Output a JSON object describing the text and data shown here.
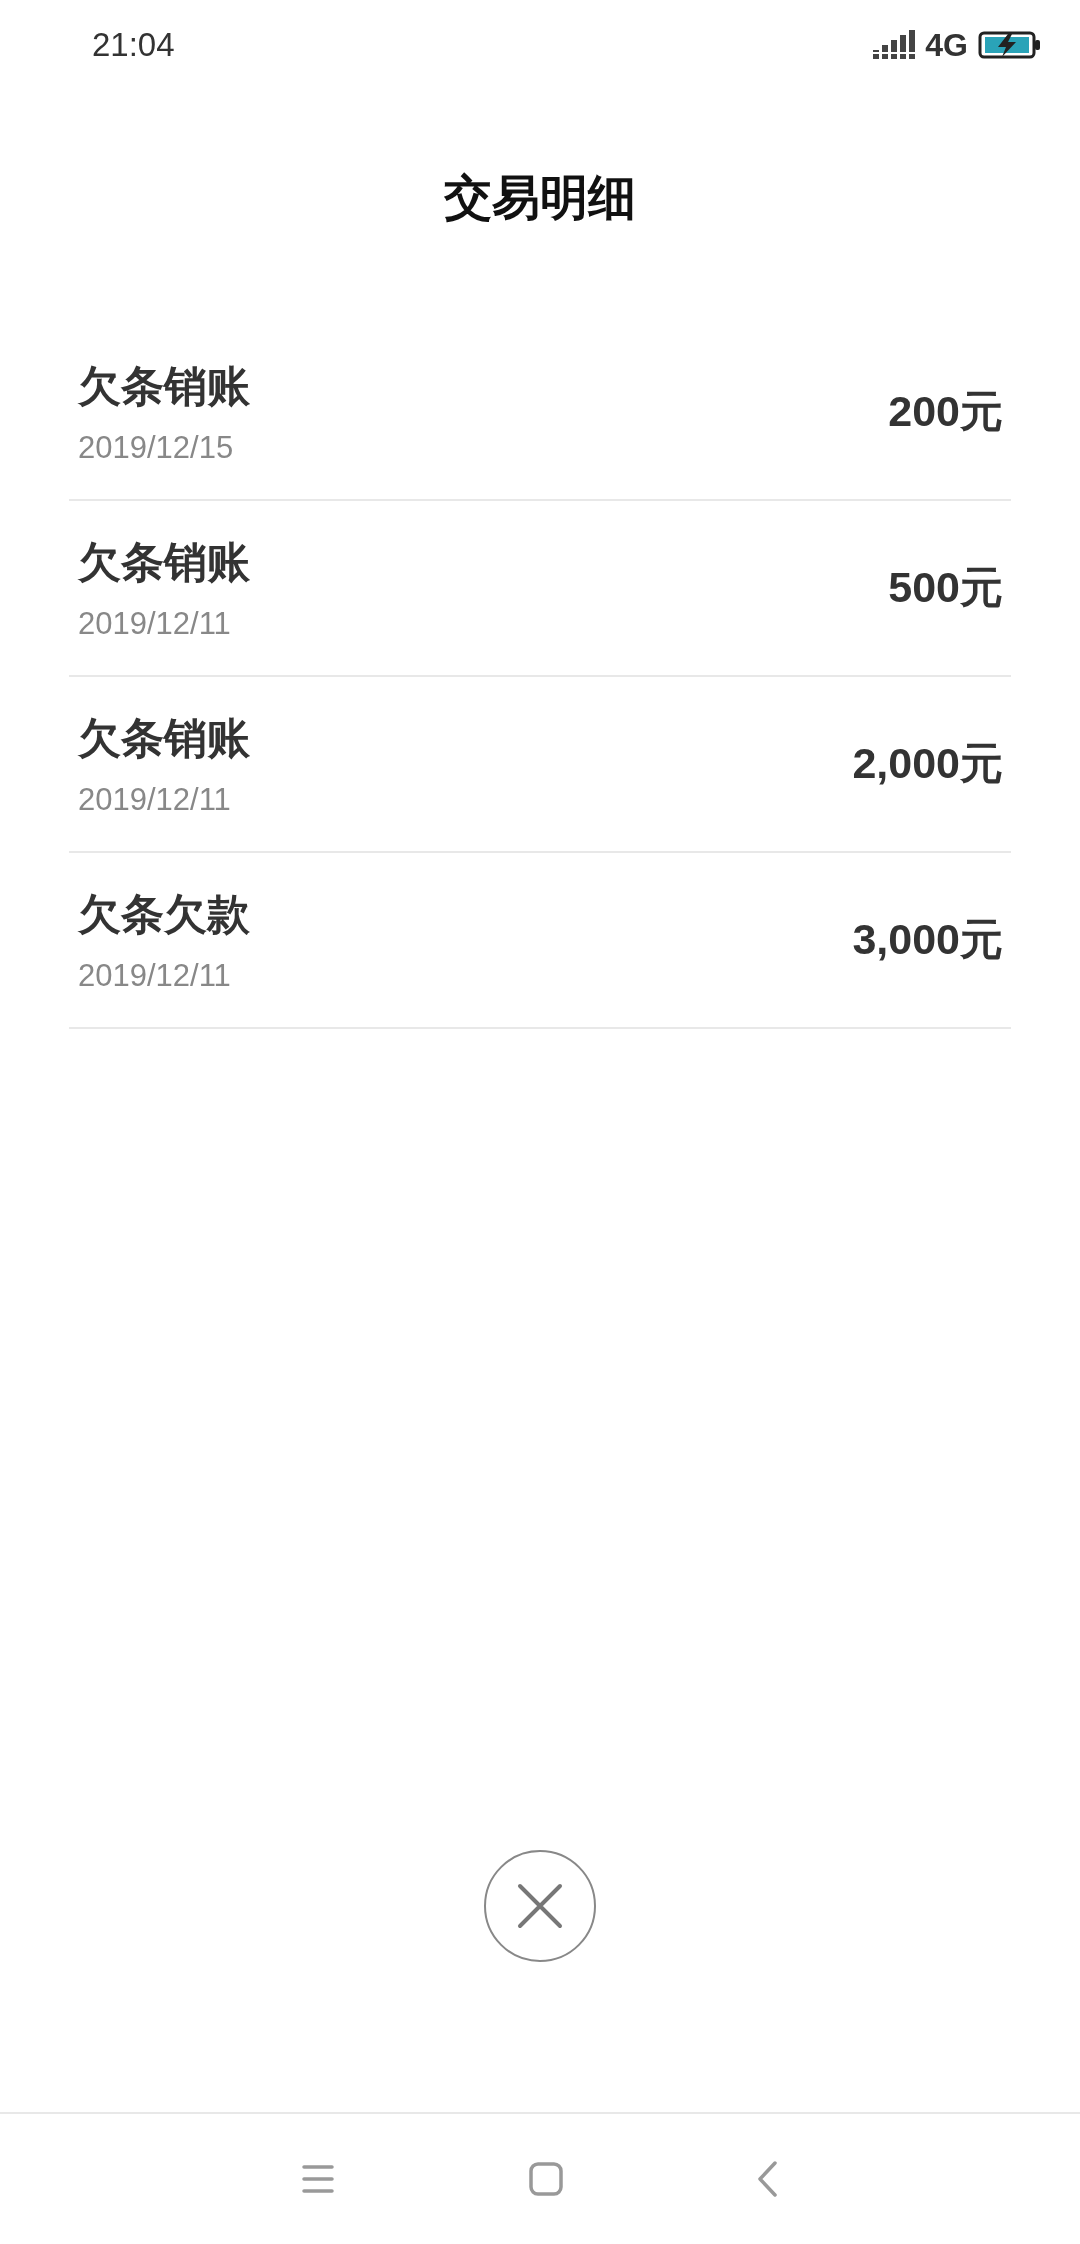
{
  "status_bar": {
    "time": "21:04",
    "network": "4G"
  },
  "title": "交易明细",
  "transactions": [
    {
      "name": "欠条销账",
      "date": "2019/12/15",
      "amount": "200元"
    },
    {
      "name": "欠条销账",
      "date": "2019/12/11",
      "amount": "500元"
    },
    {
      "name": "欠条销账",
      "date": "2019/12/11",
      "amount": "2,000元"
    },
    {
      "name": "欠条欠款",
      "date": "2019/12/11",
      "amount": "3,000元"
    }
  ]
}
